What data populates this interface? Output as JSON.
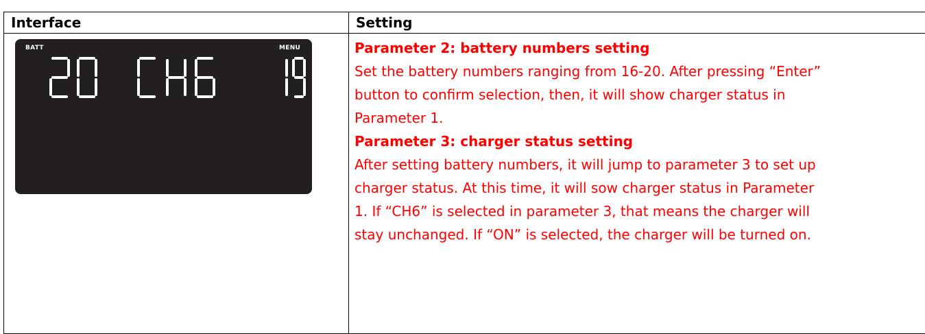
{
  "table": {
    "header_left": "Interface",
    "header_right": "Setting"
  },
  "lcd": {
    "batt_label": "BATT",
    "menu_label": "MENU",
    "left_digits": "20",
    "center_text": "CH6",
    "right_digits": "19",
    "background_color": "#231f20",
    "segment_color": "#ffffff"
  },
  "setting": {
    "param2_title": "Parameter 2: battery numbers setting",
    "param2_lines": [
      "Set the battery numbers ranging from 16-20. After pressing “Enter”",
      "button to confirm selection, then, it will show charger status in",
      "Parameter 1."
    ],
    "param3_title": "Parameter 3: charger status setting",
    "param3_lines": [
      "After setting battery numbers, it will jump to parameter 3 to set up",
      "charger status. At this time, it will sow charger status in Parameter",
      "1. If “CH6” is selected in parameter 3, that means the charger will",
      "stay unchanged. If “ON” is selected, the charger will be turned on."
    ],
    "text_color": "#ff0000"
  }
}
